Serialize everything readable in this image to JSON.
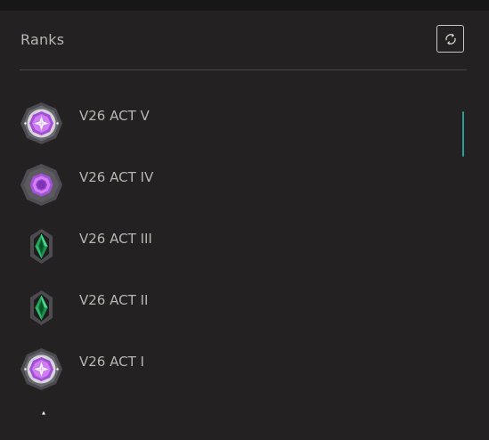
{
  "header": {
    "title": "Ranks",
    "refresh_icon": "refresh-icon"
  },
  "ranks": [
    {
      "label": "V26 ACT V",
      "icon": "platinum-star-rank-icon"
    },
    {
      "label": "V26 ACT IV",
      "icon": "platinum-rank-icon"
    },
    {
      "label": "V26 ACT III",
      "icon": "diamond-green-rank-icon"
    },
    {
      "label": "V26 ACT II",
      "icon": "diamond-green-rank-icon"
    },
    {
      "label": "V26 ACT I",
      "icon": "platinum-star-rank-icon"
    }
  ],
  "colors": {
    "background": "#232121",
    "accent": "#2f9d91",
    "text": "#b8b5b3"
  }
}
